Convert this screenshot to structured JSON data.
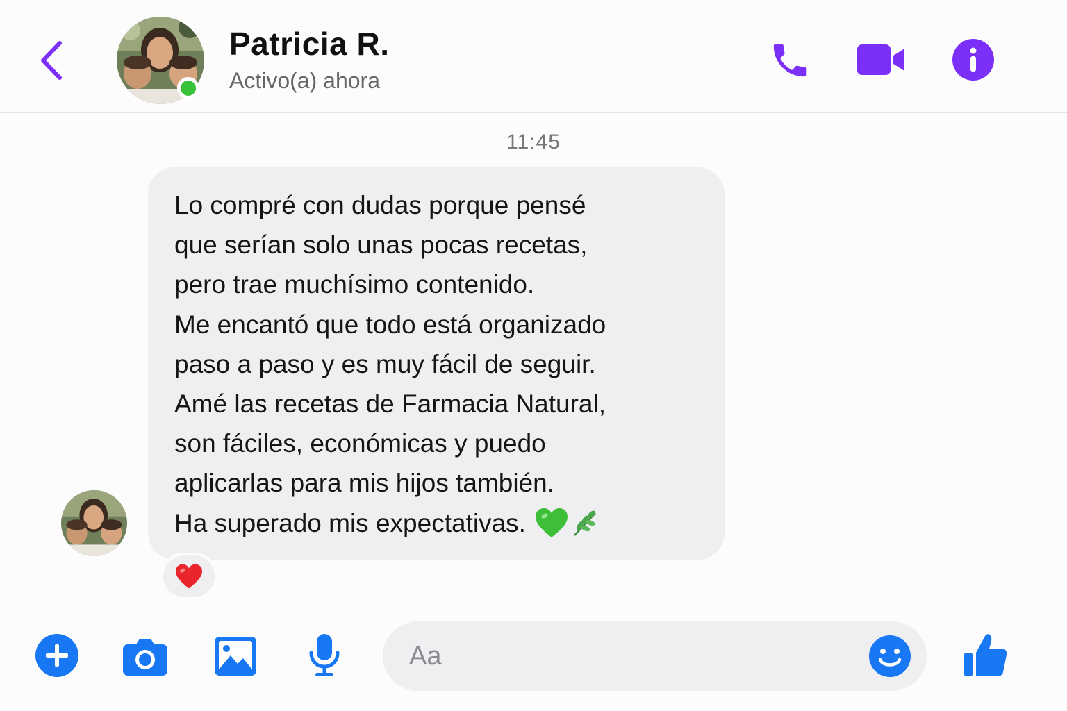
{
  "colors": {
    "accent": "#7b2ff7",
    "blue": "#1877f2",
    "online": "#38c23a",
    "heart_green": "#3fbe3a",
    "heart_red": "#e8262b"
  },
  "header": {
    "contact_name": "Patricia R.",
    "status": "Activo(a) ahora",
    "icons": [
      "chevron-left-icon",
      "phone-icon",
      "video-camera-icon",
      "info-icon"
    ]
  },
  "conversation": {
    "timestamp": "11:45",
    "message_lines": [
      "Lo compré con dudas porque pensé",
      "que serían solo unas pocas recetas,",
      "pero trae muchísimo contenido.",
      "Me encantó que todo está organizado",
      "paso a paso y es muy fácil de seguir.",
      "Amé las recetas de Farmacia Natural,",
      "son fáciles, económicas y puedo",
      "aplicarlas para mis hijos también.",
      "Ha superado mis expectativas."
    ],
    "message_emojis": [
      "green-heart-icon",
      "herb-icon"
    ],
    "reaction": "red-heart-icon"
  },
  "composer": {
    "placeholder": "Aa",
    "icons": [
      "plus-icon",
      "camera-icon",
      "image-icon",
      "microphone-icon",
      "smiley-icon",
      "thumbs-up-icon"
    ]
  }
}
